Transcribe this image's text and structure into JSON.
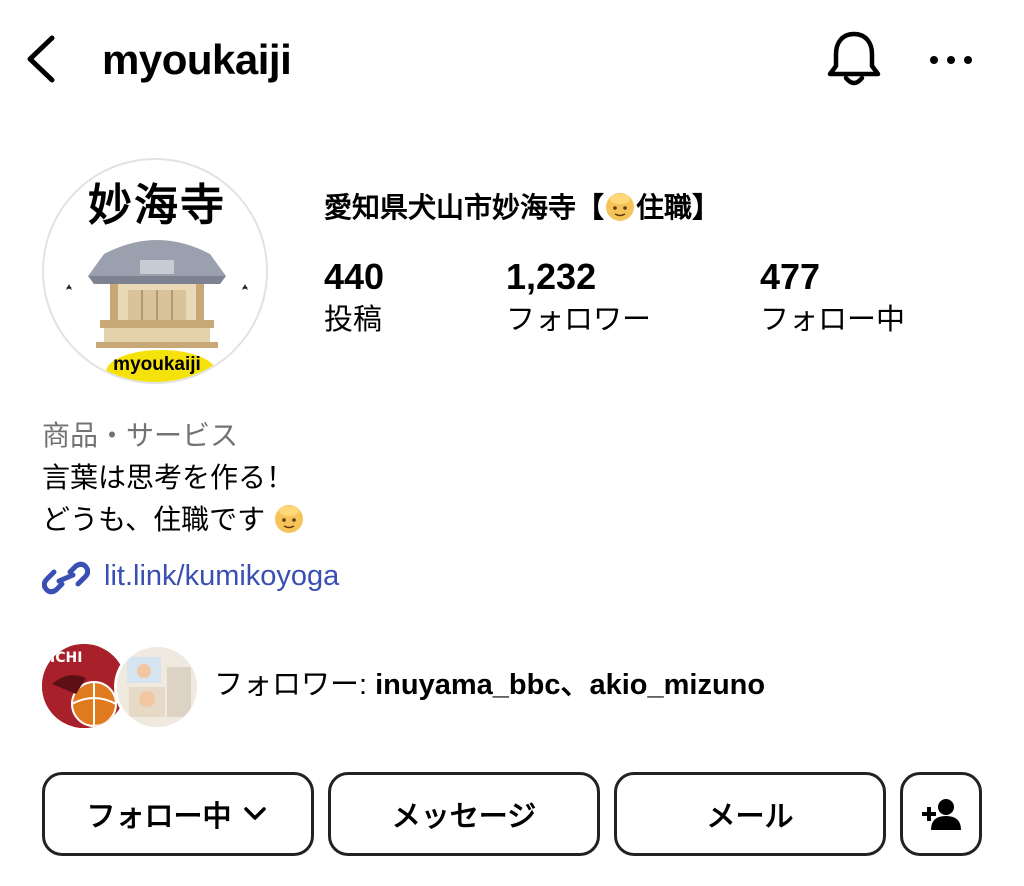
{
  "header": {
    "username": "myoukaiji",
    "back_icon": "chevron-left-icon",
    "bell_icon": "bell-icon",
    "more_icon": "more-horizontal-icon"
  },
  "avatar": {
    "title": "妙海寺",
    "badge_text": "myoukaiji"
  },
  "profile": {
    "display_name_before": "愛知県犬山市妙海寺【",
    "display_name_after": "住職】",
    "stats": {
      "posts_count": "440",
      "posts_label": "投稿",
      "followers_count": "1,232",
      "followers_label": "フォロワー",
      "following_count": "477",
      "following_label": "フォロー中"
    }
  },
  "bio": {
    "category": "商品・サービス",
    "line1": "言葉は思考を作る！",
    "line2": "どうも、住職です",
    "link": "lit.link/kumikoyoga"
  },
  "followed_by": {
    "prefix": "フォロワー: ",
    "names": "inuyama_bbc、akio_mizuno"
  },
  "actions": {
    "following_label": "フォロー中",
    "message_label": "メッセージ",
    "email_label": "メール"
  },
  "colors": {
    "link": "#3a4fb3",
    "category": "#737373",
    "badge": "#f5e20a"
  }
}
